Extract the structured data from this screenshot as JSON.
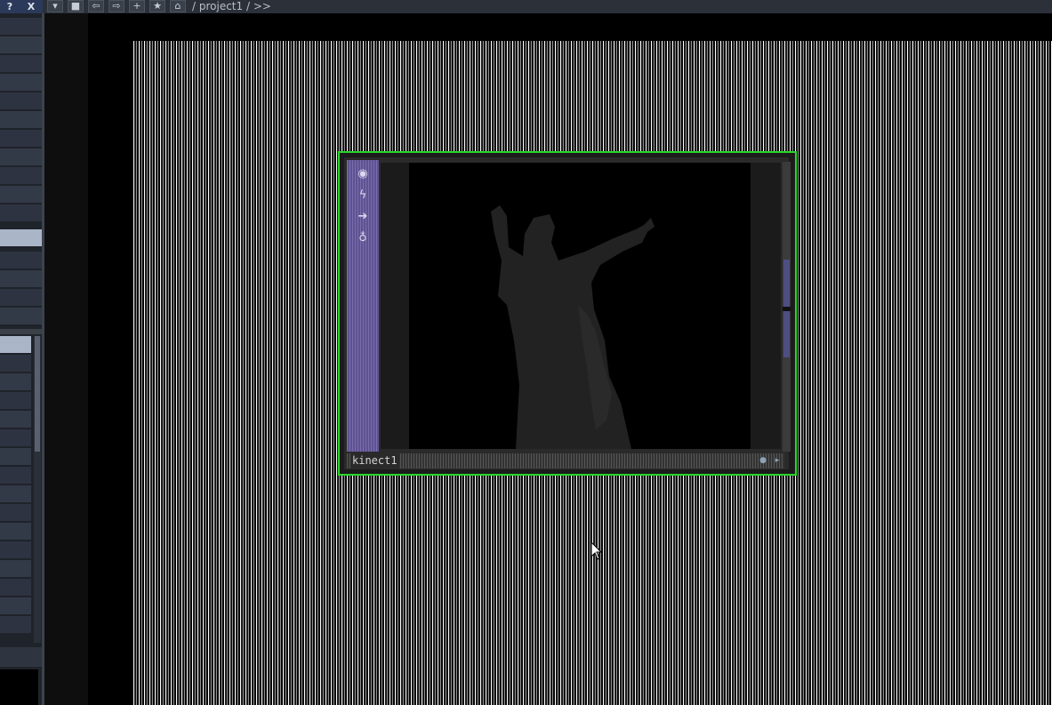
{
  "topbar": {
    "help_label": "?",
    "close_label": "X",
    "tools": [
      "▾",
      "■",
      "⇦",
      "⇨",
      "+",
      "★",
      "⌂"
    ],
    "path": "/ project1 / >>"
  },
  "node": {
    "name": "kinect1",
    "flags": [
      "◉",
      "ϟ",
      "➔",
      "♁"
    ],
    "selected_color": "#28d628"
  }
}
